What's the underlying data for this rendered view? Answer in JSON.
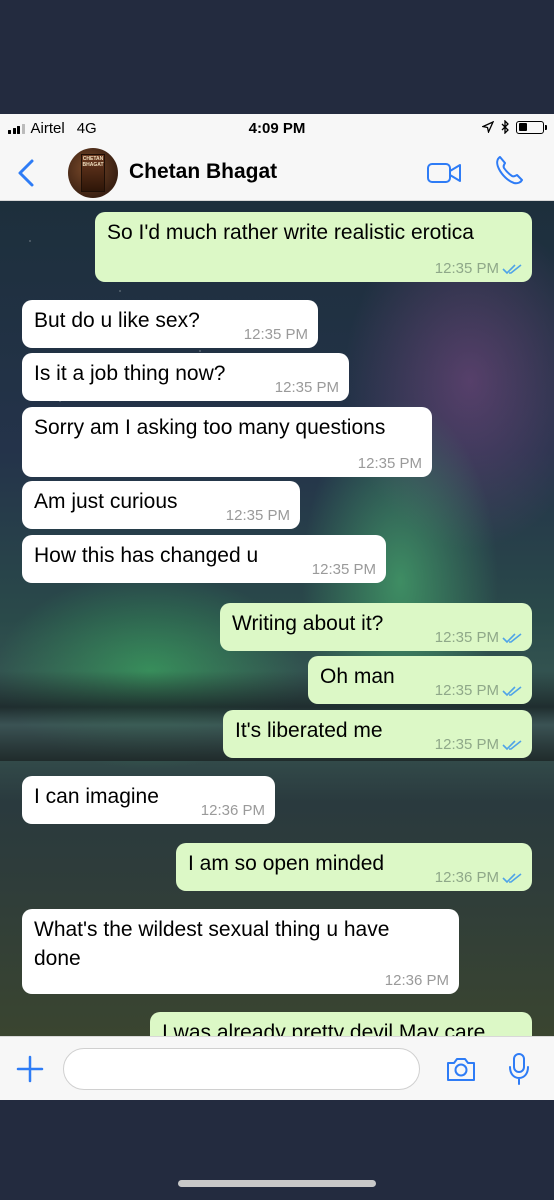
{
  "status_bar": {
    "carrier": "Airtel",
    "network": "4G",
    "time": "4:09 PM",
    "battery_level": 0.35
  },
  "header": {
    "contact_name": "Chetan Bhagat",
    "avatar_text": "CHETAN BHAGAT",
    "icons": [
      "back-chevron-icon",
      "video-call-icon",
      "phone-call-icon"
    ]
  },
  "messages": [
    {
      "direction": "out",
      "text": "So I'd much rather write realistic erotica",
      "time": "12:35 PM",
      "read": true
    },
    {
      "direction": "in",
      "text": "But do u like sex?",
      "time": "12:35 PM"
    },
    {
      "direction": "in",
      "text": "Is it a job thing now?",
      "time": "12:35 PM"
    },
    {
      "direction": "in",
      "text": "Sorry am I asking too many questions",
      "time": "12:35 PM"
    },
    {
      "direction": "in",
      "text": "Am just curious",
      "time": "12:35 PM"
    },
    {
      "direction": "in",
      "text": "How this has changed u",
      "time": "12:35 PM"
    },
    {
      "direction": "out",
      "text": "Writing about it?",
      "time": "12:35 PM",
      "read": true
    },
    {
      "direction": "out",
      "text": "Oh man",
      "time": "12:35 PM",
      "read": true
    },
    {
      "direction": "out",
      "text": "It's liberated me",
      "time": "12:35 PM",
      "read": true
    },
    {
      "direction": "in",
      "text": "I can imagine",
      "time": "12:36 PM"
    },
    {
      "direction": "out",
      "text": "I am so open minded",
      "time": "12:36 PM",
      "read": true
    },
    {
      "direction": "in",
      "text": "What's the wildest sexual thing u have done",
      "time": "12:36 PM"
    },
    {
      "direction": "out",
      "text": "I was already pretty devil May care",
      "time": "",
      "read": false
    }
  ],
  "input_bar": {
    "placeholder": "",
    "icons": [
      "plus-icon",
      "camera-icon",
      "microphone-icon"
    ]
  },
  "colors": {
    "outgoing_bubble": "#dcf8c6",
    "incoming_bubble": "#ffffff",
    "accent": "#2e7cf6",
    "read_ticks": "#4fa3e8",
    "background": "#232b3f"
  }
}
